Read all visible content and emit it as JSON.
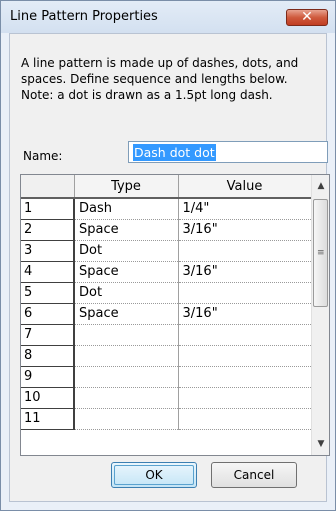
{
  "window": {
    "title": "Line Pattern Properties",
    "close_glyph": "✕"
  },
  "description": [
    "A line pattern is made up of dashes, dots, and",
    "spaces. Define sequence and lengths below.",
    "Note: a dot is drawn as a 1.5pt long dash."
  ],
  "name_field": {
    "label": "Name:",
    "value": "Dash dot dot"
  },
  "grid": {
    "columns": [
      "",
      "Type",
      "Value"
    ],
    "rows": [
      [
        "1",
        "Dash",
        "1/4\""
      ],
      [
        "2",
        "Space",
        "3/16\""
      ],
      [
        "3",
        "Dot",
        ""
      ],
      [
        "4",
        "Space",
        "3/16\""
      ],
      [
        "5",
        "Dot",
        ""
      ],
      [
        "6",
        "Space",
        "3/16\""
      ],
      [
        "7",
        "",
        ""
      ],
      [
        "8",
        "",
        ""
      ],
      [
        "9",
        "",
        ""
      ],
      [
        "10",
        "",
        ""
      ],
      [
        "11",
        "",
        ""
      ]
    ]
  },
  "scrollbar": {
    "up_glyph": "▲",
    "down_glyph": "▼",
    "grip_glyph": "≡"
  },
  "buttons": {
    "ok": "OK",
    "cancel": "Cancel"
  }
}
